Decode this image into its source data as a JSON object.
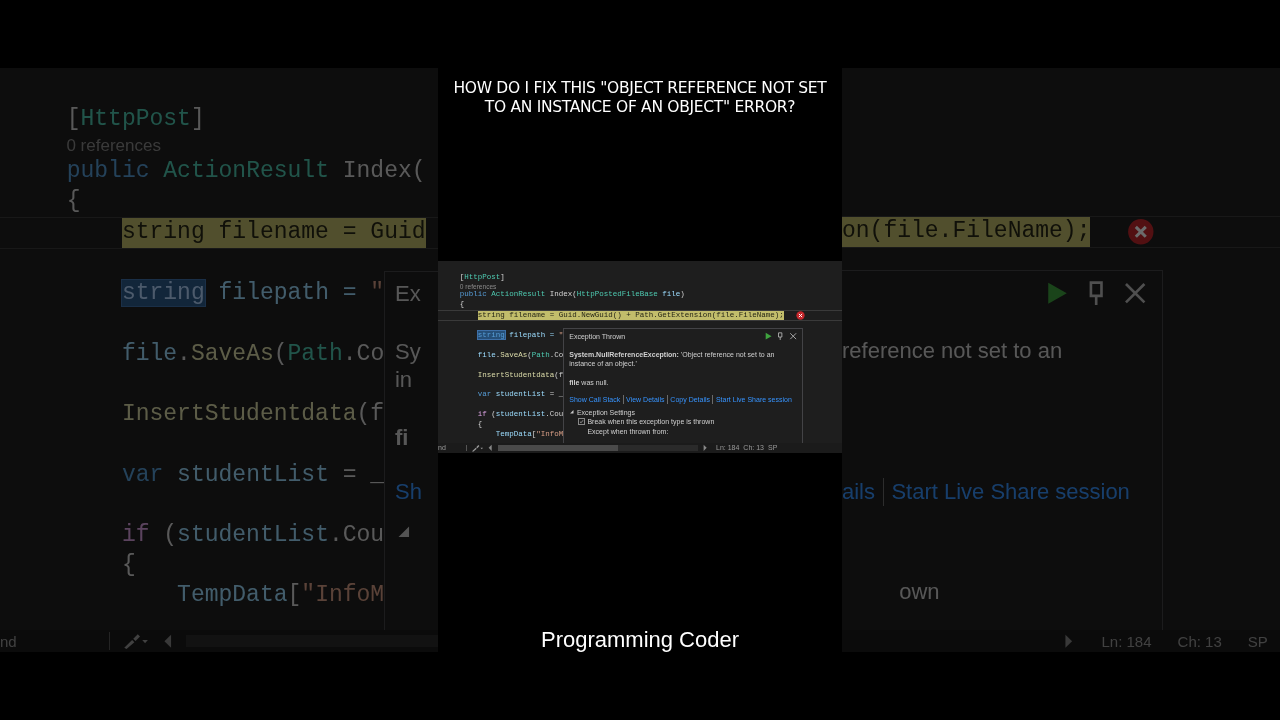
{
  "title": "HOW DO I FIX THIS \"OBJECT REFERENCE NOT SET TO AN INSTANCE OF AN OBJECT\" ERROR?",
  "backdrop_left": {
    "top": [
      {
        "kind": "attr",
        "tokens": [
          {
            "t": "[",
            "kind": "plain"
          },
          {
            "t": "HttpPost",
            "kind": "type"
          },
          {
            "t": "]",
            "kind": "plain"
          }
        ]
      },
      {
        "kind": "lens",
        "tokens": [
          {
            "t": "0 references",
            "kind": "lens"
          }
        ]
      },
      {
        "kind": "sig",
        "tokens": [
          {
            "t": "public ",
            "kind": "kw"
          },
          {
            "t": "ActionResult ",
            "kind": "type"
          },
          {
            "t": "Index(",
            "kind": "plain"
          }
        ]
      },
      {
        "kind": "brace",
        "tokens": [
          {
            "t": "{",
            "kind": "plain"
          }
        ]
      },
      {
        "kind": "current",
        "tokens": [
          {
            "t": "string filename = Guid",
            "kind": "plain"
          }
        ]
      }
    ],
    "body": [
      {
        "kind": "stmt",
        "tokens": [
          {
            "t": "string",
            "kind": "selected"
          },
          {
            "t": " filepath = ",
            "kind": "ident"
          },
          {
            "t": "\"",
            "kind": "str"
          }
        ]
      },
      {
        "kind": "stmt",
        "tokens": [
          {
            "t": "file",
            "kind": "ident"
          },
          {
            "t": ".",
            "kind": "plain"
          },
          {
            "t": "SaveAs",
            "kind": "method"
          },
          {
            "t": "(",
            "kind": "plain"
          },
          {
            "t": "Path",
            "kind": "type"
          },
          {
            "t": ".Co",
            "kind": "plain"
          }
        ]
      },
      {
        "kind": "stmt",
        "tokens": [
          {
            "t": "InsertStudentdata",
            "kind": "method"
          },
          {
            "t": "(f",
            "kind": "plain"
          }
        ]
      },
      {
        "kind": "stmt",
        "tokens": [
          {
            "t": "var",
            "kind": "kw"
          },
          {
            "t": " studentList",
            "kind": "ident"
          },
          {
            "t": " = _",
            "kind": "plain"
          }
        ]
      },
      {
        "kind": "stmt",
        "tokens": [
          {
            "t": "if",
            "kind": "ctrl"
          },
          {
            "t": " (",
            "kind": "plain"
          },
          {
            "t": "studentList",
            "kind": "ident"
          },
          {
            "t": ".Cou",
            "kind": "plain"
          }
        ]
      },
      {
        "kind": "inbrace",
        "tokens": [
          {
            "t": "{",
            "kind": "plain"
          }
        ]
      },
      {
        "kind": "inner",
        "tokens": [
          {
            "t": "TempData",
            "kind": "ident"
          },
          {
            "t": "[",
            "kind": "plain"
          },
          {
            "t": "\"InfoM",
            "kind": "str"
          }
        ]
      }
    ],
    "popup": {
      "title": "Ex",
      "message": [
        "Sy",
        "in"
      ],
      "detail": "fi",
      "link": "Sh"
    },
    "status": "nd"
  },
  "editor": {
    "top": [
      {
        "kind": "attr",
        "tokens": [
          {
            "t": "[",
            "kind": "plain"
          },
          {
            "t": "HttpPost",
            "kind": "type"
          },
          {
            "t": "]",
            "kind": "plain"
          }
        ]
      },
      {
        "kind": "lens",
        "tokens": [
          {
            "t": "0 references",
            "kind": "lens"
          }
        ]
      },
      {
        "kind": "sig",
        "tokens": [
          {
            "t": "public ",
            "kind": "kw"
          },
          {
            "t": "ActionResult ",
            "kind": "type"
          },
          {
            "t": "Index(",
            "kind": "plain"
          },
          {
            "t": "HttpPostedFileBase ",
            "kind": "type"
          },
          {
            "t": "file",
            "kind": "ident"
          },
          {
            "t": ")",
            "kind": "plain"
          }
        ]
      },
      {
        "kind": "brace",
        "tokens": [
          {
            "t": "{",
            "kind": "plain"
          }
        ]
      },
      {
        "kind": "current",
        "tokens": [
          {
            "t": "string filename = Guid.NewGuid() + Path.GetExtension(file.FileName);",
            "kind": "plain"
          }
        ]
      }
    ],
    "body": [
      {
        "kind": "stmt",
        "tokens": [
          {
            "t": "string",
            "kind": "selected"
          },
          {
            "t": " filepath = ",
            "kind": "ident"
          },
          {
            "t": "\"",
            "kind": "str"
          }
        ]
      },
      {
        "kind": "stmt",
        "tokens": [
          {
            "t": "file",
            "kind": "ident"
          },
          {
            "t": ".",
            "kind": "plain"
          },
          {
            "t": "SaveAs",
            "kind": "method"
          },
          {
            "t": "(",
            "kind": "plain"
          },
          {
            "t": "Path",
            "kind": "type"
          },
          {
            "t": ".Co",
            "kind": "plain"
          }
        ]
      },
      {
        "kind": "stmt",
        "tokens": [
          {
            "t": "InsertStudentdata",
            "kind": "method"
          },
          {
            "t": "(f",
            "kind": "plain"
          }
        ]
      },
      {
        "kind": "stmt",
        "tokens": [
          {
            "t": "var",
            "kind": "kw"
          },
          {
            "t": " studentList",
            "kind": "ident"
          },
          {
            "t": " = _",
            "kind": "plain"
          }
        ]
      },
      {
        "kind": "stmt",
        "tokens": [
          {
            "t": "if",
            "kind": "ctrl"
          },
          {
            "t": " (",
            "kind": "plain"
          },
          {
            "t": "studentList",
            "kind": "ident"
          },
          {
            "t": ".Cou",
            "kind": "plain"
          }
        ]
      },
      {
        "kind": "inbrace",
        "tokens": [
          {
            "t": "{",
            "kind": "plain"
          }
        ]
      },
      {
        "kind": "inner",
        "tokens": [
          {
            "t": "TempData",
            "kind": "ident"
          },
          {
            "t": "[",
            "kind": "plain"
          },
          {
            "t": "\"InfoM",
            "kind": "str"
          }
        ]
      }
    ],
    "exception": {
      "title": "Exception Thrown",
      "message": "**System.NullReferenceException:** 'Object reference not set to an instance of an object.'",
      "detail": "**file** was null.",
      "links": [
        "Show Call Stack",
        "View Details",
        "Copy Details",
        "Start Live Share session"
      ],
      "settings": {
        "label": "Exception Settings",
        "expanded": true,
        "break": {
          "label": "Break when this exception type is thrown",
          "checked": true
        },
        "except": "Except when thrown from:"
      }
    },
    "status": {
      "mode": "nd",
      "line": "Ln: 184",
      "col": "Ch: 13",
      "ending": "SP"
    }
  },
  "backdrop_right": {
    "tail": "on(file.FileName);",
    "popup": {
      "message": "reference not set to an",
      "links": [
        "ails",
        "Start Live Share session"
      ],
      "except": "own"
    },
    "status": [
      "Ln: 184",
      "Ch: 13",
      "SP"
    ]
  },
  "channel": "Programming Coder"
}
